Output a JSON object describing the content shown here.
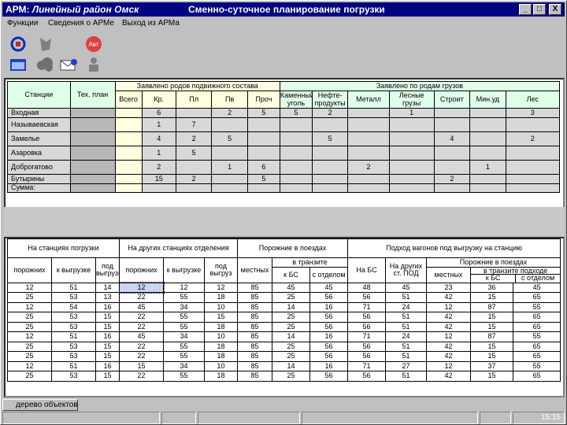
{
  "window": {
    "title_prefix": "АРМ:",
    "title_main": "Линейный район Омск",
    "title_right": "Сменно-суточное планирование погрузки",
    "btn_min": "_",
    "btn_max": "□",
    "btn_close": "X"
  },
  "menu": {
    "items": [
      "Функции",
      "Сведения о АРМе",
      "Выход из АРМа"
    ]
  },
  "toolbar": {
    "icons": [
      "refresh-icon",
      "figure-icon",
      "auto-icon",
      "calendar-icon",
      "cloud-icon",
      "envelope-icon",
      "person-icon"
    ],
    "auto_label": "Авт"
  },
  "top_table": {
    "hdr_station": "Станции",
    "hdr_tech": "Тех. план",
    "hdr_group1": "Заявлено родов подвижного состава",
    "hdr_group2": "Заявлено по родам грузов",
    "sub1": [
      "Всего",
      "Кр.",
      "Пл",
      "Пв",
      "Проч"
    ],
    "sub2": [
      "Каменный уголь",
      "Нефте-продукты",
      "Металл",
      "Лесные грузы",
      "Строит",
      "Мин.уд",
      "Лес"
    ],
    "rows": [
      {
        "station": "Входная",
        "c": [
          "",
          "6",
          "",
          "2",
          "5"
        ],
        "g": [
          "5",
          "2",
          "",
          "1",
          "",
          "",
          "3"
        ]
      },
      {
        "station": "Называевская",
        "c": [
          "",
          "1",
          "7",
          "",
          ""
        ],
        "g": [
          "",
          "",
          "",
          "",
          "",
          "",
          ""
        ]
      },
      {
        "station": "Замелье",
        "c": [
          "",
          "4",
          "2",
          "5",
          ""
        ],
        "g": [
          "",
          "5",
          "",
          "",
          "4",
          "",
          "2"
        ]
      },
      {
        "station": "Азаровка",
        "c": [
          "",
          "1",
          "5",
          "",
          ""
        ],
        "g": [
          "",
          "",
          "",
          "",
          "",
          "",
          ""
        ]
      },
      {
        "station": "Доброгатово",
        "c": [
          "",
          "2",
          "",
          "1",
          "6"
        ],
        "g": [
          "",
          "",
          "2",
          "",
          "",
          "1",
          ""
        ]
      },
      {
        "station": "Бутырины",
        "c": [
          "",
          "15",
          "2",
          "",
          "5"
        ],
        "g": [
          "",
          "",
          "",
          "",
          "2",
          "",
          ""
        ]
      },
      {
        "station": "Сумма:",
        "c": [
          "",
          "",
          "",
          "",
          ""
        ],
        "g": [
          "",
          "",
          "",
          "",
          "",
          "",
          ""
        ]
      }
    ]
  },
  "bottom_table": {
    "g1": "На станциях погрузки",
    "g2": "На других станциях отделения",
    "g3": "Порожние в поездах",
    "g4": "Подход вагонов под выгрузку на станцию",
    "g1_sub": [
      "порожних",
      "к выгрузке",
      "под выгрузкой"
    ],
    "g2_sub": [
      "порожних",
      "к выгрузке",
      "под выгруз"
    ],
    "g3_sub_local": "местных",
    "g3_sub_transit": "в транзите",
    "g3_sub_bs": "к БС",
    "g3_sub_other": "с отделом",
    "g4_sub_bs": "На БС",
    "g4_sub_other": "На других ст. ПОД",
    "g4_sub_empty": "Порожние в поездах",
    "g4_sub_local": "местных",
    "g4_sub_transit": "в транзите подходе",
    "g4_sub_bs2": "к БС",
    "g4_sub_other2": "с отделом",
    "rows": [
      [
        "12",
        "51",
        "14",
        "12",
        "12",
        "12",
        "85",
        "45",
        "45",
        "48",
        "45",
        "23",
        "36",
        "45"
      ],
      [
        "25",
        "53",
        "13",
        "22",
        "55",
        "18",
        "85",
        "25",
        "56",
        "56",
        "51",
        "42",
        "15",
        "65"
      ],
      [
        "12",
        "54",
        "16",
        "45",
        "34",
        "10",
        "85",
        "14",
        "16",
        "71",
        "24",
        "12",
        "87",
        "55"
      ],
      [
        "25",
        "53",
        "15",
        "22",
        "55",
        "15",
        "85",
        "25",
        "56",
        "56",
        "51",
        "42",
        "15",
        "65"
      ],
      [
        "25",
        "53",
        "15",
        "22",
        "55",
        "18",
        "85",
        "25",
        "56",
        "56",
        "51",
        "42",
        "15",
        "65"
      ],
      [
        "12",
        "51",
        "16",
        "45",
        "34",
        "10",
        "85",
        "14",
        "16",
        "71",
        "24",
        "12",
        "87",
        "55"
      ],
      [
        "25",
        "53",
        "15",
        "22",
        "55",
        "18",
        "85",
        "25",
        "56",
        "56",
        "51",
        "42",
        "15",
        "65"
      ],
      [
        "25",
        "53",
        "15",
        "22",
        "55",
        "18",
        "85",
        "25",
        "56",
        "56",
        "51",
        "42",
        "15",
        "65"
      ],
      [
        "12",
        "51",
        "16",
        "15",
        "34",
        "10",
        "85",
        "14",
        "16",
        "71",
        "27",
        "12",
        "37",
        "55"
      ],
      [
        "25",
        "53",
        "15",
        "22",
        "55",
        "18",
        "85",
        "25",
        "56",
        "56",
        "51",
        "42",
        "15",
        "65"
      ]
    ]
  },
  "taskbar": {
    "tree": "дерево объектов"
  },
  "status": {
    "clock": "15:15"
  }
}
